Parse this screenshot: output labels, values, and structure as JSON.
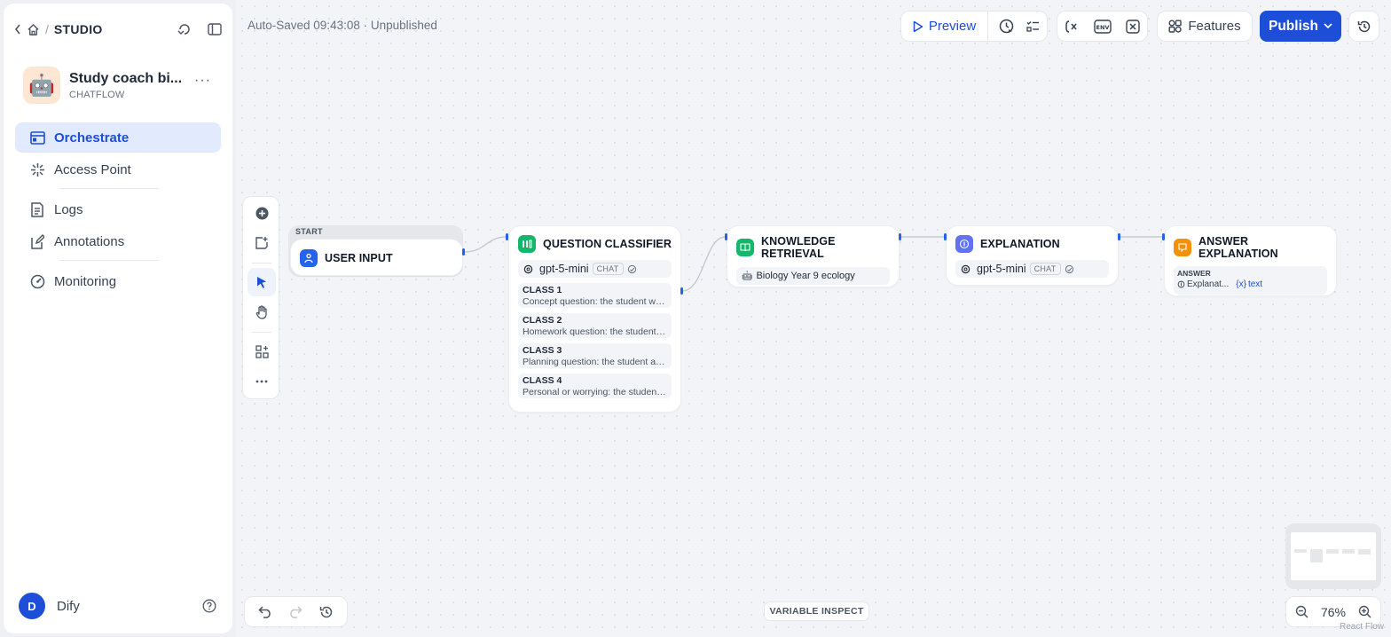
{
  "sidebar": {
    "breadcrumb": {
      "section": "STUDIO",
      "separator": "/"
    },
    "app": {
      "avatar": "🤖",
      "name": "Study coach bi...",
      "type": "CHATFLOW",
      "more": "···"
    },
    "nav": [
      {
        "label": "Orchestrate",
        "icon": "layout-icon",
        "active": true
      },
      {
        "label": "Access Point",
        "icon": "sparkle-icon",
        "active": false
      },
      {
        "label": "Logs",
        "icon": "log-icon",
        "active": false
      },
      {
        "label": "Annotations",
        "icon": "annotation-icon",
        "active": false
      },
      {
        "label": "Monitoring",
        "icon": "gauge-icon",
        "active": false
      }
    ],
    "user": {
      "initial": "D",
      "name": "Dify"
    }
  },
  "header": {
    "autosave": "Auto-Saved 09:43:08 · Unpublished",
    "preview_label": "Preview",
    "features_label": "Features",
    "publish_label": "Publish",
    "env_label": "ENV"
  },
  "workflow": {
    "start_tag": "START",
    "nodes": [
      {
        "id": "user-input",
        "title": "USER INPUT",
        "color": "#2563eb"
      },
      {
        "id": "question-classifier",
        "title": "QUESTION CLASSIFIER",
        "color": "#12b76a",
        "model": "gpt-5-mini",
        "model_tag": "CHAT",
        "classes": [
          {
            "name": "CLASS 1",
            "desc": "Concept question: the student wants"
          },
          {
            "name": "CLASS 2",
            "desc": "Homework question: the student needs"
          },
          {
            "name": "CLASS 3",
            "desc": "Planning question: the student asks"
          },
          {
            "name": "CLASS 4",
            "desc": "Personal or worrying: the student feels"
          }
        ]
      },
      {
        "id": "knowledge-retrieval",
        "title": "KNOWLEDGE RETRIEVAL",
        "color": "#12b76a",
        "dataset": "Biology Year 9 ecology",
        "dataset_icon": "🤖"
      },
      {
        "id": "explanation",
        "title": "EXPLANATION",
        "color": "#6172f3",
        "model": "gpt-5-mini",
        "model_tag": "CHAT"
      },
      {
        "id": "answer-explanation",
        "title": "ANSWER EXPLANATION",
        "color": "#f79009",
        "answer_label": "ANSWER",
        "var_node": "Explanat...",
        "var_name": "text",
        "var_prefix": "{x}"
      }
    ]
  },
  "bottom": {
    "variable_inspect": "VARIABLE INSPECT",
    "zoom": "76%",
    "attribution": "React Flow"
  }
}
